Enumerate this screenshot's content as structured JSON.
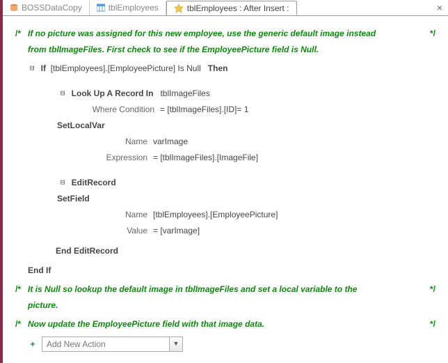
{
  "tabs": {
    "t1": "BOSSDataCopy",
    "t2": "tblEmployees",
    "t3": "tblEmployees : After Insert :"
  },
  "close": "×",
  "comment1": {
    "open": "/*",
    "text": "If no picture was assigned for this new employee, use the generic default image instead from tblImageFiles. First check to see if the EmployeePicture field is Null.",
    "close": "*/"
  },
  "if": {
    "kw": "If",
    "expr": "[tblEmployees].[EmployeePicture] Is Null",
    "then": "Then"
  },
  "lookup": {
    "kw": "Look Up A Record In",
    "target": "tblImageFiles"
  },
  "where": {
    "label": "Where Condition",
    "expr": "= [tblImageFiles].[ID]= 1"
  },
  "setlocal": {
    "kw": "SetLocalVar"
  },
  "nv": {
    "nameLabel": "Name",
    "nameVal": "varImage",
    "exprLabel": "Expression",
    "exprVal": "= [tblImageFiles].[ImageFile]"
  },
  "editrec": {
    "kw": "EditRecord"
  },
  "setfield": {
    "kw": "SetField"
  },
  "sf": {
    "nameLabel": "Name",
    "nameVal": "[tblEmployees].[EmployeePicture]",
    "valLabel": "Value",
    "valVal": "= [varImage]"
  },
  "endedit": "End EditRecord",
  "endif": "End If",
  "comment2": {
    "open": "/*",
    "text": "It is Null so lookup the default image in tblImageFiles and set a local variable to the picture.",
    "close": "*/"
  },
  "comment3": {
    "open": "/*",
    "text": "Now update the EmployeePicture field with that image data.",
    "close": "*/"
  },
  "addnew": {
    "placeholder": "Add New Action"
  },
  "toggle_minus": "⊟",
  "plus": "+"
}
